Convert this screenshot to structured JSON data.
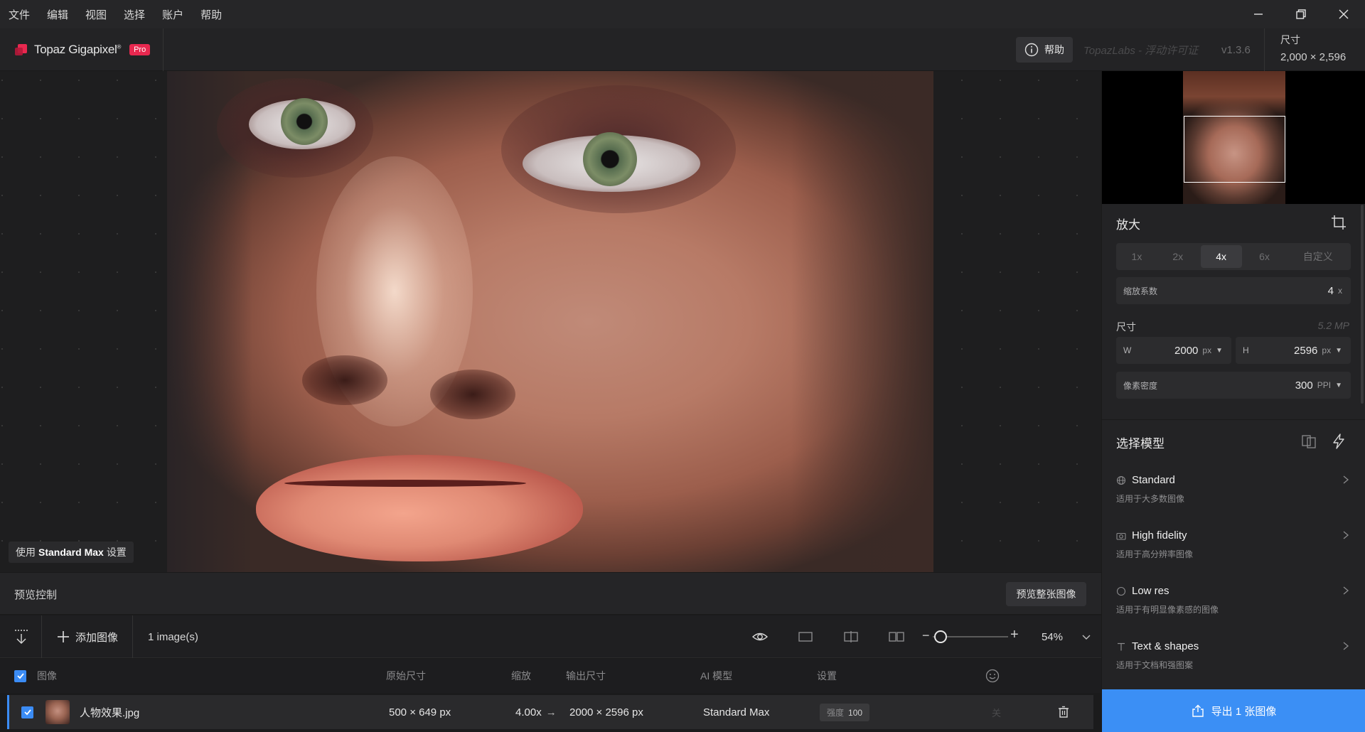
{
  "menu": [
    "文件",
    "编辑",
    "视图",
    "选择",
    "账户",
    "帮助"
  ],
  "app": {
    "name": "Topaz Gigapixel",
    "trademark": "®",
    "badge": "Pro",
    "help_label": "帮助",
    "license_text": "TopazLabs - 浮动许可证",
    "version": "v1.3.6",
    "size_label": "尺寸",
    "size_value": "2,000 × 2,596"
  },
  "canvas": {
    "overlay_prefix": "使用",
    "overlay_model": "Standard Max",
    "overlay_suffix": "设置"
  },
  "preview": {
    "label": "预览控制",
    "full_button": "预览整张图像"
  },
  "toolbar": {
    "add_image": "添加图像",
    "count": "1 image(s)",
    "zoom": "54%",
    "zoom_level": 0.1
  },
  "table": {
    "headers": {
      "image": "图像",
      "original": "原始尺寸",
      "scale": "缩放",
      "output": "输出尺寸",
      "model": "AI 模型",
      "settings": "设置"
    },
    "rows": [
      {
        "name": "人物效果.jpg",
        "original": "500 × 649 px",
        "scale": "4.00x",
        "arrow": "→",
        "output": "2000 × 2596 px",
        "model": "Standard Max",
        "strength_label": "强度",
        "strength_value": "100",
        "face_status": "关"
      }
    ]
  },
  "panel": {
    "upscale_title": "放大",
    "scale_options": [
      "1x",
      "2x",
      "4x",
      "6x",
      "自定义"
    ],
    "active_scale": "4x",
    "scale_factor_label": "缩放系数",
    "scale_factor_value": "4",
    "scale_factor_unit": "x",
    "dimension_label": "尺寸",
    "megapixels": "5.2 MP",
    "width_label": "W",
    "width_value": "2000",
    "width_unit": "px",
    "height_label": "H",
    "height_value": "2596",
    "height_unit": "px",
    "density_label": "像素密度",
    "density_value": "300",
    "density_unit": "PPI",
    "model_title": "选择模型",
    "models": [
      {
        "name": "Standard",
        "desc": "适用于大多数图像",
        "icon": "globe-icon"
      },
      {
        "name": "High fidelity",
        "desc": "适用于高分辨率图像",
        "icon": "camera-icon"
      },
      {
        "name": "Low res",
        "desc": "适用于有明显像素感的图像",
        "icon": "circle-icon"
      },
      {
        "name": "Text & shapes",
        "desc": "适用于文档和强图案",
        "icon": "text-icon"
      }
    ],
    "export_label": "导出 1 张图像"
  },
  "colors": {
    "accent": "#3b8ff5",
    "badge": "#e8284f",
    "background": "#1b1b1c"
  }
}
